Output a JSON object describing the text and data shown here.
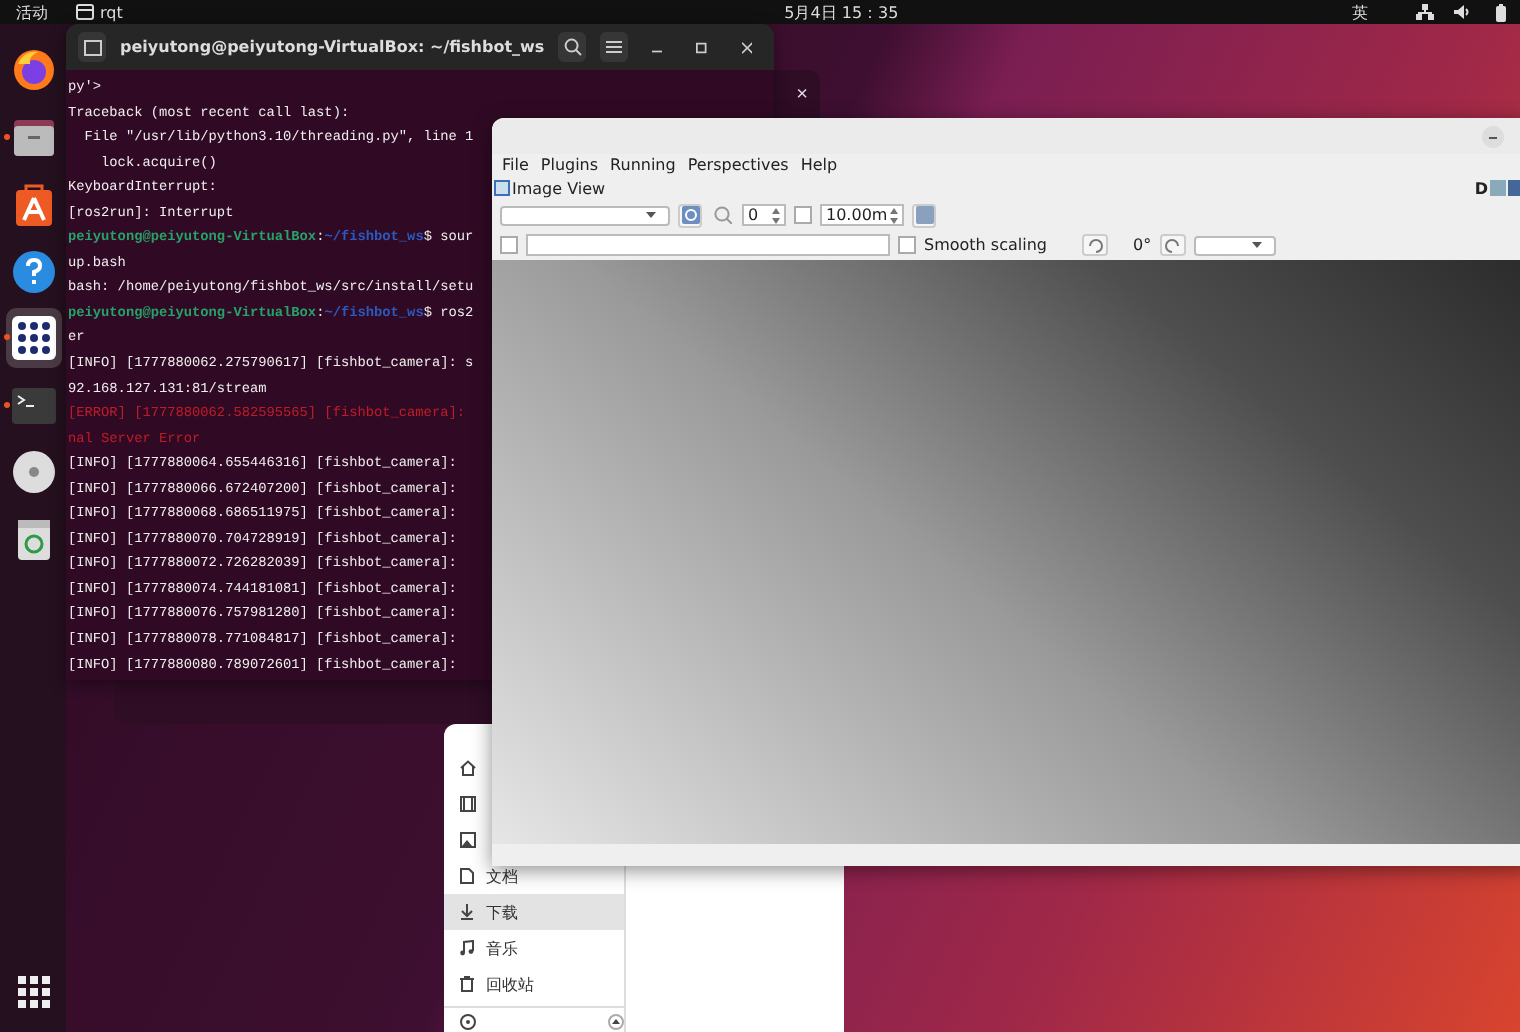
{
  "top_bar": {
    "activities": "活动",
    "app_name": "rqt",
    "clock": "5月4日 15：35",
    "input_method": "英"
  },
  "dock": {
    "items": [
      {
        "kind": "firefox",
        "running": false
      },
      {
        "kind": "files",
        "running": true
      },
      {
        "kind": "store",
        "running": false
      },
      {
        "kind": "help",
        "running": false
      },
      {
        "kind": "grid",
        "running": true
      },
      {
        "kind": "terminal",
        "running": true
      },
      {
        "kind": "disc",
        "running": false
      },
      {
        "kind": "trash",
        "running": false
      }
    ]
  },
  "dialog": {
    "close": "×"
  },
  "terminal": {
    "title": "peiyutong@peiyutong-VirtualBox: ~/fishbot_ws",
    "lines": [
      {
        "kind": "plain",
        "text": "py'>"
      },
      {
        "kind": "plain",
        "text": "Traceback (most recent call last):"
      },
      {
        "kind": "plain",
        "text": "  File \"/usr/lib/python3.10/threading.py\", line 1"
      },
      {
        "kind": "plain",
        "text": "    lock.acquire()"
      },
      {
        "kind": "plain",
        "text": "KeyboardInterrupt:"
      },
      {
        "kind": "plain",
        "text": "[ros2run]: Interrupt"
      },
      {
        "kind": "prompt",
        "user": "peiyutong@peiyutong-VirtualBox",
        "sep": ":",
        "path": "~/fishbot_ws",
        "command": "$ sour"
      },
      {
        "kind": "plain",
        "text": "up.bash"
      },
      {
        "kind": "plain",
        "text": "bash: /home/peiyutong/fishbot_ws/src/install/setu"
      },
      {
        "kind": "prompt",
        "user": "peiyutong@peiyutong-VirtualBox",
        "sep": ":",
        "path": "~/fishbot_ws",
        "command": "$ ros2"
      },
      {
        "kind": "plain",
        "text": "er"
      },
      {
        "kind": "plain",
        "text": "[INFO] [1777880062.275790617] [fishbot_camera]: s"
      },
      {
        "kind": "plain",
        "text": "92.168.127.131:81/stream"
      },
      {
        "kind": "error",
        "text": "[ERROR] [1777880062.582595565] [fishbot_camera]:"
      },
      {
        "kind": "error",
        "text": "nal Server Error"
      },
      {
        "kind": "plain",
        "text": "[INFO] [1777880064.655446316] [fishbot_camera]:"
      },
      {
        "kind": "plain",
        "text": "[INFO] [1777880066.672407200] [fishbot_camera]:"
      },
      {
        "kind": "plain",
        "text": "[INFO] [1777880068.686511975] [fishbot_camera]:"
      },
      {
        "kind": "plain",
        "text": "[INFO] [1777880070.704728919] [fishbot_camera]:"
      },
      {
        "kind": "plain",
        "text": "[INFO] [1777880072.726282039] [fishbot_camera]:"
      },
      {
        "kind": "plain",
        "text": "[INFO] [1777880074.744181081] [fishbot_camera]:"
      },
      {
        "kind": "plain",
        "text": "[INFO] [1777880076.757981280] [fishbot_camera]:"
      },
      {
        "kind": "plain",
        "text": "[INFO] [1777880078.771084817] [fishbot_camera]:"
      },
      {
        "kind": "plain",
        "text": "[INFO] [1777880080.789072601] [fishbot_camera]:"
      }
    ]
  },
  "file_manager": {
    "places": [
      {
        "kind": "home",
        "selected": false
      },
      {
        "kind": "video",
        "selected": false
      },
      {
        "kind": "image",
        "selected": false
      },
      {
        "label": "文档",
        "kind": "doc",
        "selected": false
      },
      {
        "label": "下载",
        "kind": "download",
        "selected": true
      },
      {
        "label": "音乐",
        "kind": "music",
        "selected": false
      },
      {
        "label": "回收站",
        "kind": "trash",
        "selected": false
      }
    ]
  },
  "rqt": {
    "menu": [
      "File",
      "Plugins",
      "Running",
      "Perspectives",
      "Help"
    ],
    "plugin_title": "Image View",
    "plugin_flag": "D",
    "topic_checkbox": {
      "checked": false
    },
    "zoom_value": "0",
    "max_checkbox": {
      "checked": false
    },
    "max_value": "10.00m",
    "smooth_scaling": {
      "label": "Smooth scaling",
      "checked": false
    },
    "rotation": "0°"
  }
}
